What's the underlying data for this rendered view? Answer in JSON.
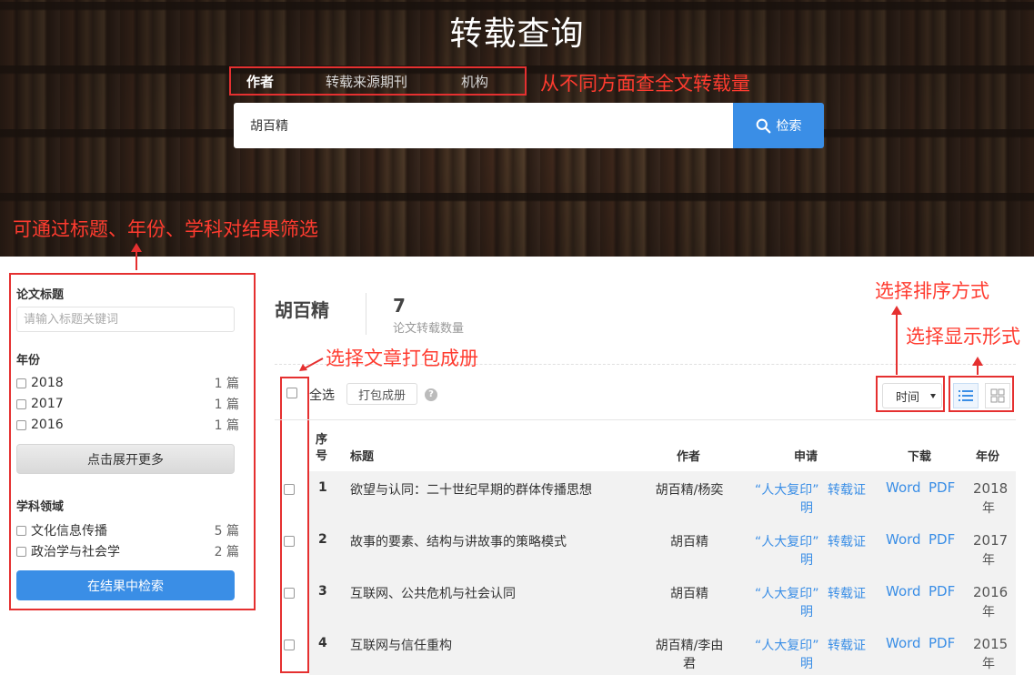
{
  "hero": {
    "title": "转载查询"
  },
  "search": {
    "tabs": [
      "作者",
      "转载来源期刊",
      "机构"
    ],
    "value": "胡百精",
    "button_label": "检索"
  },
  "annotations": {
    "tabs_note": "从不同方面查全文转载量",
    "filter_note": "可通过标题、年份、学科对结果筛选",
    "pack_note": "选择文章打包成册",
    "sort_note": "选择排序方式",
    "display_note": "选择显示形式"
  },
  "sidebar": {
    "title_section": {
      "heading": "论文标题",
      "placeholder": "请输入标题关键词"
    },
    "year_section": {
      "heading": "年份",
      "items": [
        {
          "label": "2018",
          "count": "1 篇"
        },
        {
          "label": "2017",
          "count": "1 篇"
        },
        {
          "label": "2016",
          "count": "1 篇"
        }
      ],
      "more_button": "点击展开更多"
    },
    "subject_section": {
      "heading": "学科领域",
      "items": [
        {
          "label": "文化信息传播",
          "count": "5 篇"
        },
        {
          "label": "政治学与社会学",
          "count": "2 篇"
        }
      ]
    },
    "search_in_results": "在结果中检索"
  },
  "results": {
    "author": "胡百精",
    "count": "7",
    "count_label": "论文转载数量",
    "select_all": "全选",
    "pack_button": "打包成册",
    "sort_value": "时间",
    "columns": {
      "index_1": "序",
      "index_2": "号",
      "title": "标题",
      "author": "作者",
      "apply": "申请",
      "download": "下载",
      "year": "年份"
    },
    "rows": [
      {
        "num": "1",
        "title": "欲望与认同：二十世纪早期的群体传播思想",
        "author_1": "胡百精/杨奕",
        "author_2": "",
        "apply_1": "“人大复印”",
        "apply_2": "明",
        "cert": "转载证",
        "word": "Word",
        "pdf": "PDF",
        "year_1": "2018",
        "year_2": "年"
      },
      {
        "num": "2",
        "title": "故事的要素、结构与讲故事的策略模式",
        "author_1": "胡百精",
        "author_2": "",
        "apply_1": "“人大复印”",
        "apply_2": "明",
        "cert": "转载证",
        "word": "Word",
        "pdf": "PDF",
        "year_1": "2017",
        "year_2": "年"
      },
      {
        "num": "3",
        "title": "互联网、公共危机与社会认同",
        "author_1": "胡百精",
        "author_2": "",
        "apply_1": "“人大复印”",
        "apply_2": "明",
        "cert": "转载证",
        "word": "Word",
        "pdf": "PDF",
        "year_1": "2016",
        "year_2": "年"
      },
      {
        "num": "4",
        "title": "互联网与信任重构",
        "author_1": "胡百精/李由",
        "author_2": "君",
        "apply_1": "“人大复印”",
        "apply_2": "明",
        "cert": "转载证",
        "word": "Word",
        "pdf": "PDF",
        "year_1": "2015",
        "year_2": "年"
      }
    ]
  },
  "colors": {
    "accent": "#3a8ee6",
    "annotation": "#ff3b2f"
  },
  "icons": {
    "search": "search-icon",
    "help": "help-icon",
    "list_view": "list-view-icon",
    "grid_view": "grid-view-icon"
  }
}
